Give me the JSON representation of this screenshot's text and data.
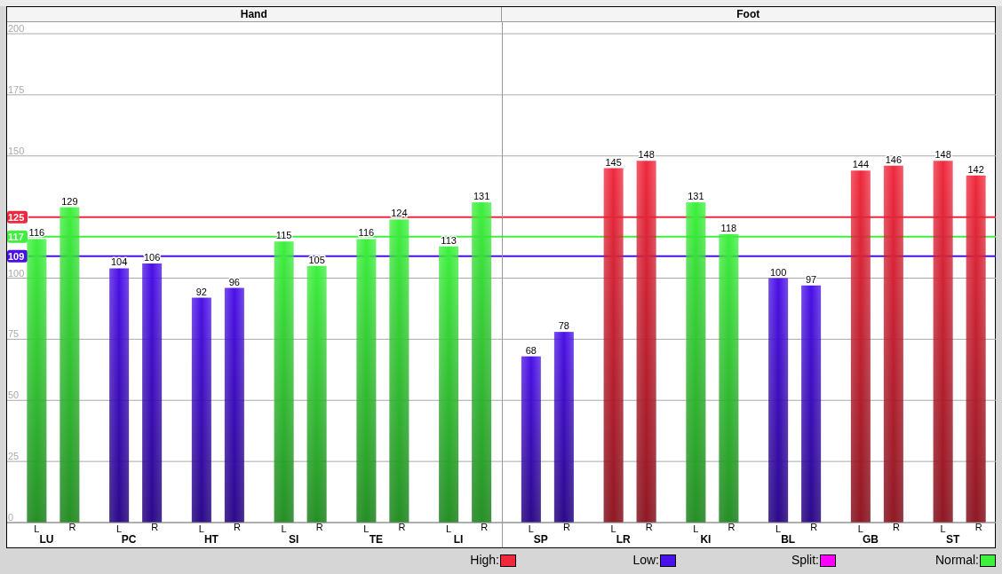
{
  "sections": [
    {
      "label": "Hand"
    },
    {
      "label": "Foot"
    }
  ],
  "chart_data": {
    "type": "bar",
    "categories": [
      "LU",
      "PC",
      "HT",
      "SI",
      "TE",
      "LI",
      "SP",
      "LR",
      "KI",
      "BL",
      "GB",
      "ST"
    ],
    "series": [
      {
        "name": "L",
        "values": [
          116,
          104,
          92,
          115,
          116,
          113,
          68,
          145,
          131,
          100,
          144,
          148
        ],
        "colors": [
          "#3cf03c",
          "#4a10e8",
          "#4a10e8",
          "#3cf03c",
          "#3cf03c",
          "#3cf03c",
          "#4a10e8",
          "#f0283c",
          "#3cf03c",
          "#4a10e8",
          "#f0283c",
          "#f0283c"
        ]
      },
      {
        "name": "R",
        "values": [
          129,
          106,
          96,
          105,
          124,
          131,
          78,
          148,
          118,
          97,
          146,
          142
        ],
        "colors": [
          "#3cf03c",
          "#4a10e8",
          "#4a10e8",
          "#3cf03c",
          "#3cf03c",
          "#3cf03c",
          "#4a10e8",
          "#f0283c",
          "#3cf03c",
          "#4a10e8",
          "#f0283c",
          "#f0283c"
        ]
      }
    ],
    "ylim": [
      0,
      200
    ],
    "yticks": [
      0,
      25,
      50,
      75,
      100,
      150,
      175,
      200
    ],
    "data_labels": true,
    "grid": true,
    "ref_lines": [
      {
        "axis": "y",
        "value": 125,
        "label": "125",
        "color": "#f0283c"
      },
      {
        "axis": "y",
        "value": 117,
        "label": "117",
        "color": "#3cf03c"
      },
      {
        "axis": "y",
        "value": 109,
        "label": "109",
        "color": "#4a10e8"
      }
    ]
  },
  "legend": [
    {
      "label": "High:",
      "color": "#f0283c"
    },
    {
      "label": "Low:",
      "color": "#4a10e8"
    },
    {
      "label": "Split:",
      "color": "#ff00ff"
    },
    {
      "label": "Normal:",
      "color": "#3cf03c"
    }
  ]
}
